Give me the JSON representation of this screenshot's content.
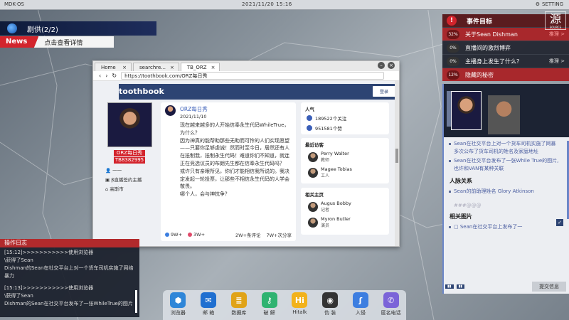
{
  "topbar": {
    "os": "MDK-OS",
    "time": "2021/11/20   15:16   ",
    "setting": "SETTING"
  },
  "news": {
    "title": "剧供(2/2)",
    "label": "News",
    "more": "点击查看详情"
  },
  "browser": {
    "tabs": [
      {
        "label": "Home"
      },
      {
        "label": "searchre..."
      },
      {
        "label": "TB_ORZ"
      }
    ],
    "url": "https://toothbook.com/ORZ每日秀",
    "site_logo": "toothbook",
    "login": "登录",
    "profile": {
      "name": "ORZ每日秀",
      "id": "TB8382995",
      "followers": "一一",
      "job": "β直播签约主播",
      "city": "高斯市"
    },
    "post": {
      "author": "ORZ每日秀",
      "date": "2021/11/10",
      "body": [
        "现在越来越多的人开始信奉永生代码WhileTrue，为什么？",
        "因为神真的能帮助那些无助而可怜的人们实现愿望——只要你足够虔诚！然而时至今日，居然还有人在抵制我，抵制永生代码！难道你们不知道，就连正在竞选议员的布朗先生都在信奉永生代码吗？",
        "或许只有亲眼所见，你们才能相信我所说的。我决定发起一轮投票，让那些不相信永生代码的人学会敬畏。",
        "哪个人，会与神抗争？"
      ],
      "likes": "9W+",
      "hearts": "3W+",
      "comments": "2W+条评论",
      "shares": "7W+次分享"
    },
    "popularity": {
      "title": "人气",
      "followers": "189522个关注",
      "likes": "951581个赞"
    },
    "visitors": {
      "title": "最近访客",
      "items": [
        {
          "name": "Perry Walter",
          "role": "教师"
        },
        {
          "name": "Magee Tobias",
          "role": "工人"
        }
      ]
    },
    "related": {
      "title": "相关主页",
      "items": [
        {
          "name": "Augus Bobby",
          "role": "记者"
        },
        {
          "name": "Myron Butler",
          "role": "演员"
        }
      ]
    }
  },
  "events": {
    "title": "事件目标",
    "items": [
      {
        "pct": "32%",
        "label": "关于Sean Dishman",
        "trace": "推理 >"
      },
      {
        "pct": "0%",
        "label": "直播间的激烈博弈",
        "trace": ""
      },
      {
        "pct": "0%",
        "label": "主播身上发生了什么?",
        "trace": "推理 >"
      },
      {
        "pct": "12%",
        "label": "隐藏的秘密",
        "trace": ""
      }
    ]
  },
  "detail": {
    "clues": [
      "Sean在社交平台上对一个货车司机实施了网暴多次公布了货车司机的姓名及家庭地址",
      "Sean在社交平台发布了一张While True的图片,也许和VAN有某种关联"
    ],
    "relations_title": "人脉关系",
    "relation": "Sean的前助理姓名 Glory Atkinson",
    "faint": "###@@@",
    "images_title": "相关图片",
    "image_clue": "Sean在社交平台上发布了一",
    "submit": "提交信息"
  },
  "log": {
    "title": "操作日志",
    "lines": [
      "[15:12]>>>>>>>>>>>使用浏览器",
      "\\获得了Sean",
      "Dishman的Sean在社交平台上对一个货车司机实施了网络暴力",
      "",
      "[15:13]>>>>>>>>>>>使用浏览器",
      "\\获得了Sean",
      "Dishman的Sean在社交平台发布了一张WhileTrue的图片"
    ]
  },
  "dock": [
    {
      "label": "浏览器",
      "icon": "browser-icon",
      "glyph": "⬢",
      "color": "#2f86d8"
    },
    {
      "label": "邮 箱",
      "icon": "mail-icon",
      "glyph": "✉",
      "color": "#1f6fd0"
    },
    {
      "label": "数据库",
      "icon": "database-icon",
      "glyph": "≣",
      "color": "#e0a318"
    },
    {
      "label": "破 解",
      "icon": "crack-icon",
      "glyph": "⚷",
      "color": "#2fb371"
    },
    {
      "label": "Hitalk",
      "icon": "hitalk-icon",
      "glyph": "Hi",
      "color": "#f2b21b"
    },
    {
      "label": "伪 装",
      "icon": "disguise-icon",
      "glyph": "◉",
      "color": "#333333"
    },
    {
      "label": "入侵",
      "icon": "intrude-icon",
      "glyph": "ʃ",
      "color": "#3d7ee0"
    },
    {
      "label": "匿名电话",
      "icon": "phone-icon",
      "glyph": "✆",
      "color": "#7b64d8"
    }
  ]
}
